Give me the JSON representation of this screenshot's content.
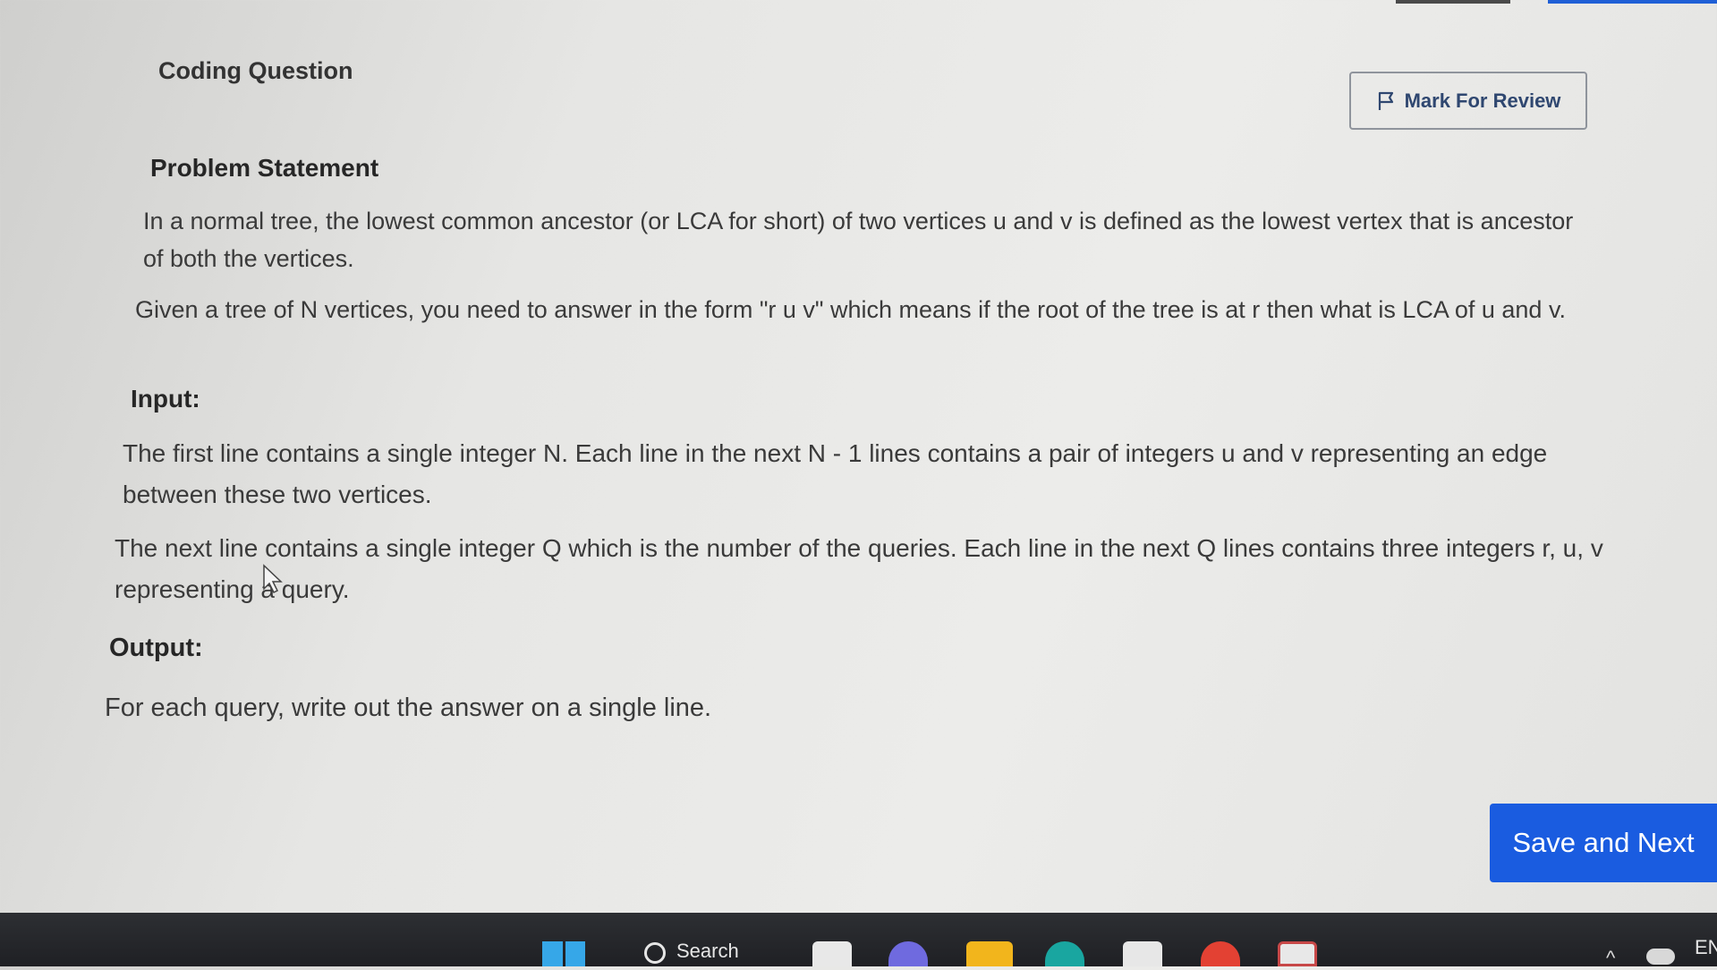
{
  "header": {
    "title": "Coding Question",
    "mark_for_review_label": "Mark For Review",
    "mark_icon": "flag-icon"
  },
  "problem": {
    "heading": "Problem Statement",
    "p1": "In a normal tree, the lowest common ancestor (or LCA for short) of two vertices u and v is defined as the lowest vertex that is ancestor of both the vertices.",
    "p2": "Given a tree of N vertices, you need to answer in the form \"r u v\" which means if the root of the tree is at r then what is LCA of u and v.",
    "input_heading": "Input:",
    "input_p1": "The first line contains a single integer N. Each line in the next N - 1 lines contains a pair of integers u and v representing an edge between these two vertices.",
    "input_p2": "The next line contains a single integer Q which is the number of the queries. Each line in the next Q lines contains three integers r, u, v representing a query.",
    "output_heading": "Output:",
    "output_p1": "For each query, write out the answer on a single line."
  },
  "footer": {
    "save_next_label": "Save and Next",
    "accent_color": "#1a5ce0"
  },
  "taskbar": {
    "search_label": "Search",
    "language": "EN",
    "icons": [
      "windows-start-icon",
      "search-icon",
      "file-explorer-icon",
      "meet-icon",
      "folder-icon",
      "edge-icon",
      "store-icon",
      "chrome-icon",
      "snipping-tool-icon",
      "chevron-up-icon",
      "onedrive-icon"
    ]
  }
}
